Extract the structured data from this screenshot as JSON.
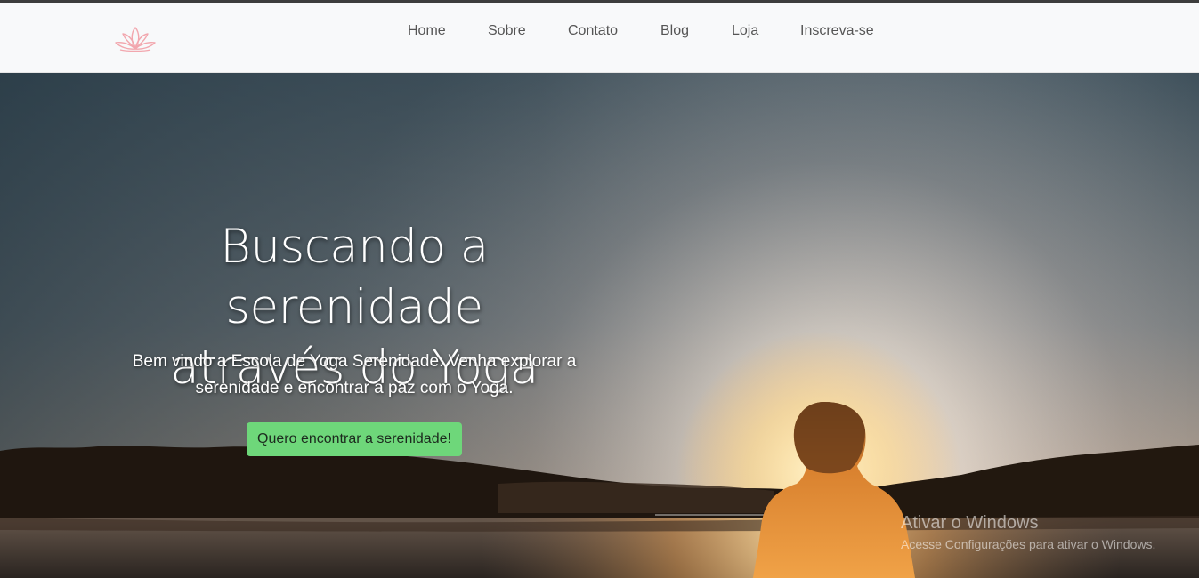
{
  "navbar": {
    "logo_icon": "lotus-icon",
    "logo_color": "#f2a7ae",
    "links": [
      {
        "label": "Home"
      },
      {
        "label": "Sobre"
      },
      {
        "label": "Contato"
      },
      {
        "label": "Blog"
      },
      {
        "label": "Loja"
      },
      {
        "label": "Inscreva-se"
      }
    ]
  },
  "hero": {
    "title_line1": "Buscando a serenidade",
    "title_line2": "através do Yoga",
    "subtitle_line1": "Bem vindo a Escola de Yoga Serenidade. Venha explorar a",
    "subtitle_line2": "serenidade e encontrar a paz com o Yoga.",
    "cta_label": "Quero encontrar a serenidade!",
    "cta_color": "#6ed77a"
  },
  "watermark": {
    "title": "Ativar o Windows",
    "subtitle": "Acesse Configurações para ativar o Windows."
  }
}
